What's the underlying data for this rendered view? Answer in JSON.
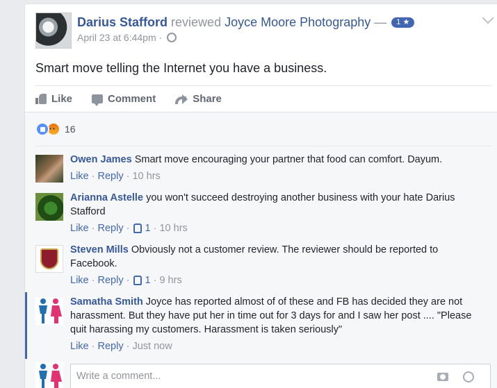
{
  "post": {
    "author": "Darius Stafford",
    "action": "reviewed",
    "page": "Joyce Moore Photography",
    "dash": "—",
    "rating_badge": "1 ★",
    "time": "April 23 at 6:44pm",
    "separator": "·",
    "text": "Smart move telling the Internet you have a business."
  },
  "actions": {
    "like": "Like",
    "comment": "Comment",
    "share": "Share"
  },
  "reactions": {
    "count": "16"
  },
  "comments": [
    {
      "name": "Owen James",
      "text": "Smart move encouraging your partner that food can comfort. Dayum.",
      "like": "Like",
      "reply": "Reply",
      "likes": "",
      "time": "10 hrs"
    },
    {
      "name": "Arianna Astelle",
      "text": "you won't succeed destroying another business with your hate Darius Stafford",
      "like": "Like",
      "reply": "Reply",
      "likes": "1",
      "time": "10 hrs"
    },
    {
      "name": "Steven Mills",
      "text": "Obviously not a customer review. The reviewer should be reported to Facebook.",
      "like": "Like",
      "reply": "Reply",
      "likes": "1",
      "time": "9 hrs"
    },
    {
      "name": "Samatha Smith",
      "text": "Joyce has reported almost of of these and FB has decided they are not harassment. But they have put her in time out for 3 days for and I saw her post .... \"Please quit harassing my customers. Harassment is taken seriously\"",
      "like": "Like",
      "reply": "Reply",
      "likes": "",
      "time": "Just now"
    }
  ],
  "composer": {
    "placeholder": "Write a comment..."
  },
  "colors": {
    "link": "#365899",
    "accent": "#4267b2",
    "muted": "#90949c"
  }
}
